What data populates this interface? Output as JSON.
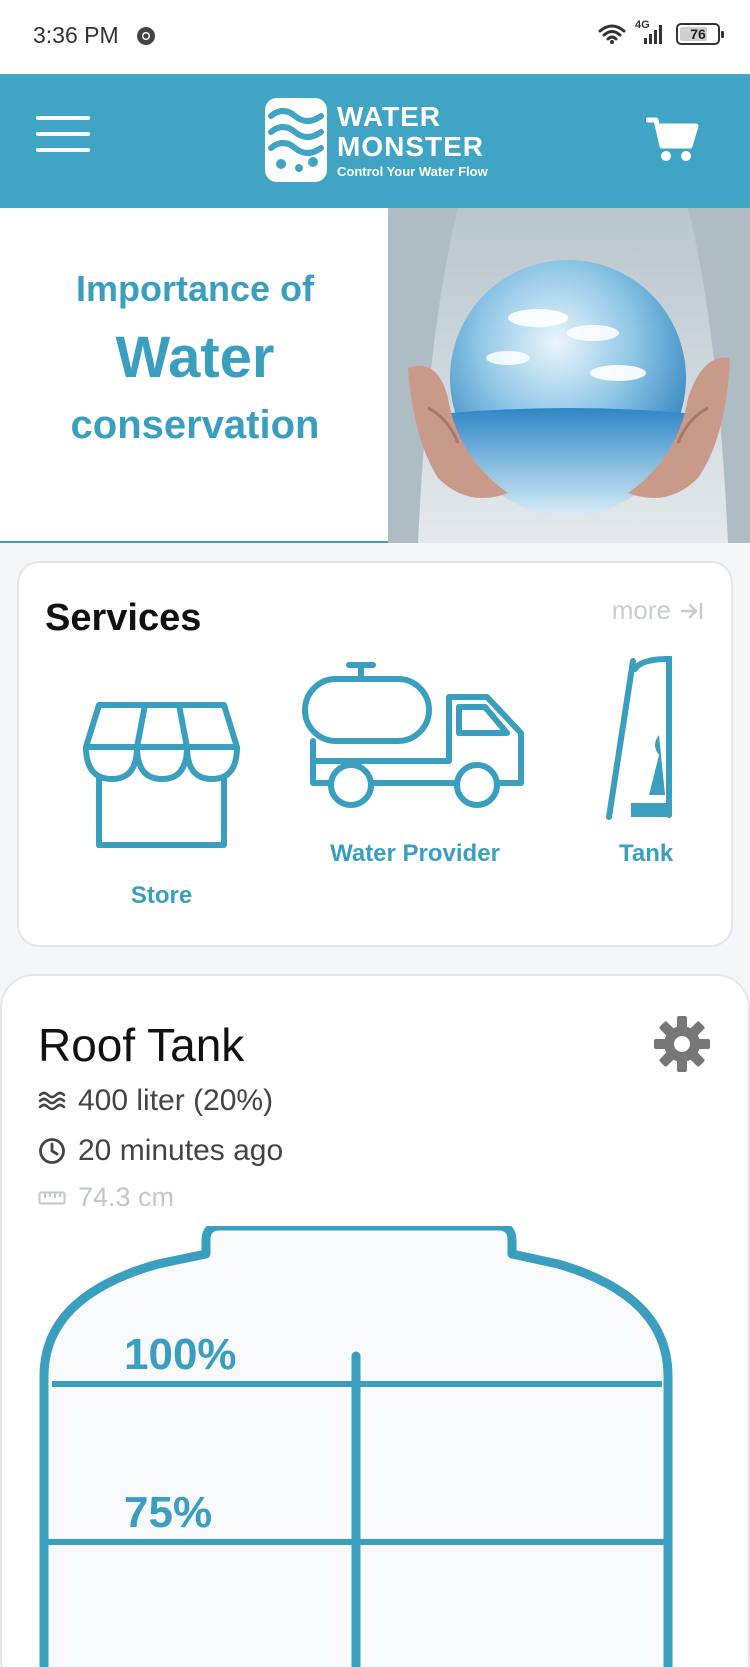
{
  "status_bar": {
    "time": "3:36 PM",
    "network": "4G",
    "battery": "76",
    "battery_level": 0.76
  },
  "app_bar": {
    "logo_line1": "WATER",
    "logo_line2": "MONSTER",
    "logo_tagline": "Control Your Water Flow",
    "menu_icon": "hamburger-menu-icon",
    "cart_icon": "shopping-cart-icon"
  },
  "banner": {
    "line1": "Importance of",
    "line2": "Water",
    "line3": "conservation"
  },
  "services": {
    "title": "Services",
    "more_label": "more",
    "items": [
      {
        "label": "Store",
        "icon": "store-icon"
      },
      {
        "label": "Water Provider",
        "icon": "water-truck-icon"
      },
      {
        "label": "Tank",
        "icon": "tank-icon"
      }
    ]
  },
  "tank": {
    "name": "Roof Tank",
    "volume": "400 liter (20%)",
    "last_update": "20 minutes ago",
    "height": "74.3 cm",
    "fill_fraction": 0.2,
    "levels": [
      "100%",
      "75%"
    ]
  },
  "colors": {
    "brand": "#40a4c4",
    "accent": "#3a9fbe",
    "muted": "#c2c7cc"
  }
}
